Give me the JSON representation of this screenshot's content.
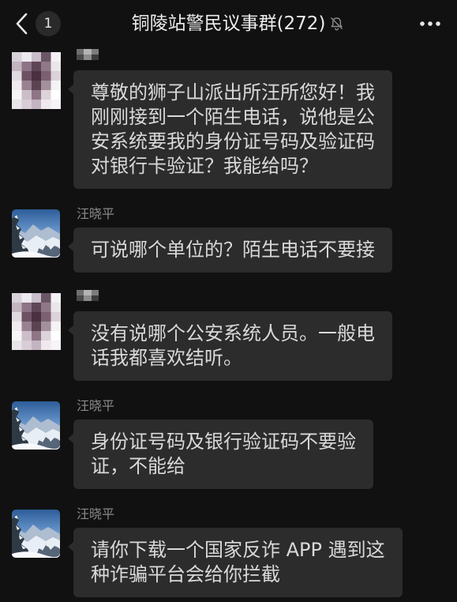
{
  "header": {
    "back_icon": "chevron-left-icon",
    "unread_count": "1",
    "title": "铜陵站警民议事群(272)",
    "mute_icon": "bell-slash-icon",
    "more_icon": "more-dots-icon"
  },
  "theme": {
    "background": "#111111",
    "bubble": "#2c2c2c",
    "text": "#d9d9d9",
    "name": "#8a8a8a"
  },
  "messages": [
    {
      "avatar_icon": "mosaic-avatar-icon",
      "lines": [
        "尊敬的狮子山派出所汪所您好！我",
        "刚刚接到一个陌生电话，说他是公",
        "安系统要我的身份证号码及验证码",
        "对银行卡验证？我能给吗？"
      ]
    },
    {
      "sender": "汪晓平",
      "avatar_icon": "snow-landscape-avatar-icon",
      "lines": [
        "可说哪个单位的？陌生电话不要接"
      ]
    },
    {
      "avatar_icon": "mosaic-avatar-icon",
      "lines": [
        "没有说哪个公安系统人员。一般电",
        "话我都喜欢结听。"
      ]
    },
    {
      "sender": "汪晓平",
      "avatar_icon": "snow-landscape-avatar-icon",
      "lines": [
        "身份证号码及银行验证码不要验",
        "证，不能给"
      ]
    },
    {
      "sender": "汪晓平",
      "avatar_icon": "snow-landscape-avatar-icon",
      "lines": [
        "请你下载一个国家反诈 APP 遇到这",
        "种诈骗平台会给你拦截"
      ]
    }
  ]
}
